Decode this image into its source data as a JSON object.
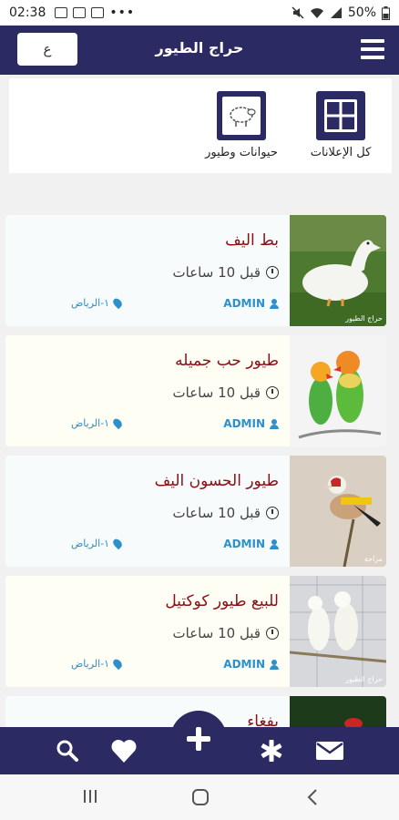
{
  "status_bar": {
    "time": "02:38",
    "battery": "50%"
  },
  "header": {
    "title": "حراج الطيور",
    "lang_button": "ع"
  },
  "categories": [
    {
      "label": "كل الإعلانات",
      "icon": "grid-icon"
    },
    {
      "label": "حيوانات وطيور",
      "icon": "sheep-icon"
    }
  ],
  "listings": [
    {
      "title": "بط اليف",
      "time": "قبل 10 ساعات",
      "author": "ADMIN",
      "location": "١-الرياض",
      "image": "duck-photo",
      "watermark": "حراج الطيور"
    },
    {
      "title": "طيور حب جميله",
      "time": "قبل 10 ساعات",
      "author": "ADMIN",
      "location": "١-الرياض",
      "image": "lovebirds-photo",
      "watermark": ""
    },
    {
      "title": "طيور الحسون اليف",
      "time": "قبل 10 ساعات",
      "author": "ADMIN",
      "location": "١-الرياض",
      "image": "goldfinch-photo",
      "watermark": "مزاجة"
    },
    {
      "title": "للبيع طيور كوكتيل",
      "time": "قبل 10 ساعات",
      "author": "ADMIN",
      "location": "١-الرياض",
      "image": "cockatiel-photo",
      "watermark": "حراج الطيور"
    },
    {
      "title": "بفغاء",
      "time": "",
      "author": "",
      "location": "",
      "image": "parrot-photo",
      "watermark": ""
    }
  ],
  "bottom_nav": [
    "search-icon",
    "heart-icon",
    "add-icon",
    "asterisk-icon",
    "mail-icon"
  ],
  "colors": {
    "primary": "#2b2a63",
    "title_red": "#8b0f14",
    "link_blue": "#2e8fca"
  }
}
